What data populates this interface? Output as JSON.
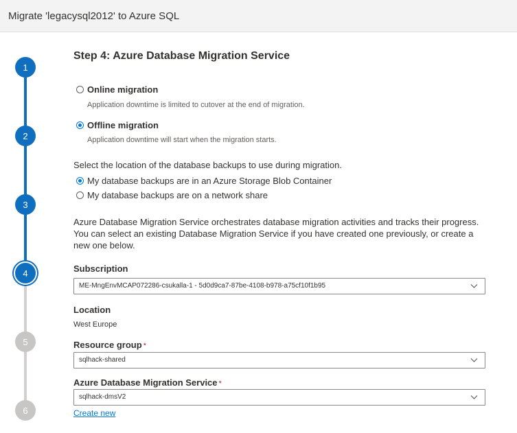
{
  "window": {
    "title": "Migrate 'legacysql2012' to Azure SQL"
  },
  "stepper": {
    "steps": [
      "1",
      "2",
      "3",
      "4",
      "5",
      "6"
    ]
  },
  "page": {
    "heading": "Step 4: Azure Database Migration Service"
  },
  "migration_mode": {
    "online": {
      "label": "Online migration",
      "description": "Application downtime is limited to cutover at the end of migration."
    },
    "offline": {
      "label": "Offline migration",
      "description": "Application downtime will start when the migration starts."
    },
    "selected": "offline"
  },
  "backup_location": {
    "prompt": "Select the location of the database backups to use during migration.",
    "blob": "My database backups are in an Azure Storage Blob Container",
    "network": "My database backups are on a network share",
    "selected": "blob"
  },
  "info": {
    "line1": "Azure Database Migration Service orchestrates database migration activities and tracks their progress.",
    "line2": "You can select an existing Database Migration Service if you have created one previously, or create a",
    "line3": "new one below."
  },
  "subscription": {
    "label": "Subscription",
    "value": "ME-MngEnvMCAP072286-csukalla-1 - 5d0d9ca7-87be-4108-b978-a75cf10f1b95"
  },
  "location": {
    "label": "Location",
    "value": "West Europe"
  },
  "resource_group": {
    "label": "Resource group",
    "required_mark": "*",
    "value": "sqlhack-shared"
  },
  "dms": {
    "label": "Azure Database Migration Service",
    "required_mark": "*",
    "value": "sqlhack-dmsV2",
    "create_new": "Create new"
  },
  "colors": {
    "accent": "#0078d4",
    "step_done": "#106ebe",
    "step_todo": "#c8c6c4",
    "required": "#a4262c"
  }
}
